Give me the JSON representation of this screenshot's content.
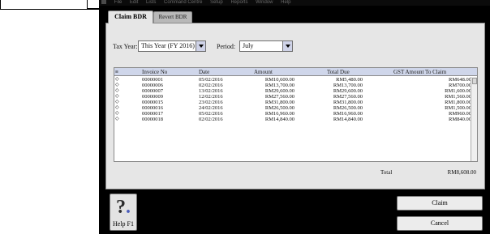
{
  "menubar": {
    "items": [
      "File",
      "Edit",
      "Lists",
      "Command Centre",
      "Setup",
      "Reports",
      "Window",
      "Help"
    ]
  },
  "tabs": [
    {
      "label": "Claim BDR",
      "active": true
    },
    {
      "label": "Revert BDR",
      "active": false
    }
  ],
  "filters": {
    "tax_year_label": "Tax Year:",
    "tax_year_value": "This Year (FY 2016)",
    "period_label": "Period:",
    "period_value": "July"
  },
  "grid": {
    "columns": [
      "Invoice No",
      "Date",
      "Amount",
      "Total Due",
      "GST Amount To Claim"
    ],
    "rows": [
      [
        "00000001",
        "05/02/2016",
        "RM10,600.00",
        "RM5,480.00",
        "RM648.00"
      ],
      [
        "00000006",
        "02/02/2016",
        "RM13,700.00",
        "RM13,700.00",
        "RM700.00"
      ],
      [
        "00000007",
        "13/02/2016",
        "RM29,600.00",
        "RM29,600.00",
        "RM1,600.00"
      ],
      [
        "00000009",
        "12/02/2016",
        "RM27,560.00",
        "RM27,560.00",
        "RM1,560.00"
      ],
      [
        "00000015",
        "23/02/2016",
        "RM31,800.00",
        "RM31,800.00",
        "RM1,800.00"
      ],
      [
        "00000016",
        "24/02/2016",
        "RM26,500.00",
        "RM26,500.00",
        "RM1,500.00"
      ],
      [
        "00000017",
        "05/02/2016",
        "RM16,960.00",
        "RM16,960.00",
        "RM960.00"
      ],
      [
        "00000018",
        "02/02/2016",
        "RM14,840.00",
        "RM14,840.00",
        "RM840.00"
      ]
    ]
  },
  "total": {
    "label": "Total",
    "value": "RM8,608.00"
  },
  "help_button": {
    "label": "Help F1"
  },
  "buttons": {
    "claim": "Claim",
    "cancel": "Cancel"
  }
}
